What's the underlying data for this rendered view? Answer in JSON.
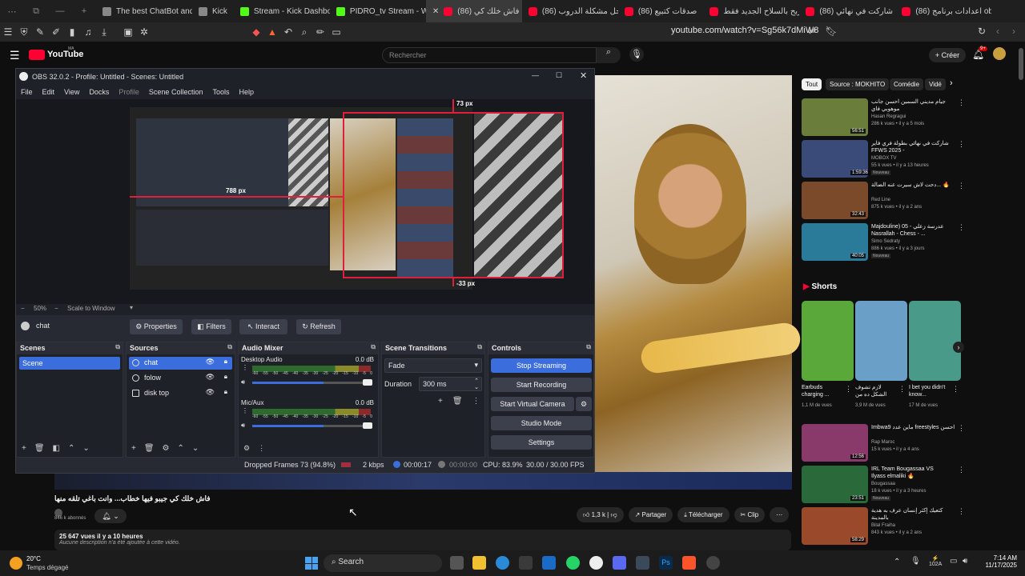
{
  "browser": {
    "tabs": [
      {
        "label": "The best ChatBot and",
        "icon": "gray"
      },
      {
        "label": "Kick",
        "icon": "gray"
      },
      {
        "label": "Stream - Kick Dashbo",
        "icon": "kick"
      },
      {
        "label": "PIDRO_tv Stream - Wa",
        "icon": "kick"
      },
      {
        "label": "(86) فاش خلك كي",
        "icon": "yt",
        "active": true
      },
      {
        "label": "(86) حل مشكلة الدروب",
        "icon": "yt"
      },
      {
        "label": "(86) صدقات كتبيع",
        "icon": "yt"
      },
      {
        "label": "الربح بالسلاح الجديد فقط",
        "icon": "yt"
      },
      {
        "label": "(86) شاركت في نهائي",
        "icon": "yt"
      },
      {
        "label": "(86) اعدادات برنامج obs",
        "icon": "yt"
      }
    ],
    "url": "youtube.com/watch?v=Sg56k7dMiW8"
  },
  "youtube": {
    "logo": "YouTube",
    "logo_region": "MA",
    "search_placeholder": "Rechercher",
    "create_label": "Créer",
    "notif_count": "9+",
    "chips": [
      "Tout",
      "Source : MOKHITO",
      "Comédie",
      "Vidé"
    ],
    "recommendations": [
      {
        "title": "جيام مديني السمين احسن جانب موهوبي فاي",
        "title2": "الاوروبية بسبب ناصبة وعادي ..دير كذا",
        "channel": "Hasan Regragui",
        "views": "286 k vues • il y a 5 mois",
        "duration": "56:51",
        "color": "#6b7d3a"
      },
      {
        "title": "شاركت في نهائي بطولة فري فاير",
        "title2": "FFWS 2025 -",
        "channel": "MOBOX TV",
        "views": "55 k vues • il y a 13 heures",
        "badge": "Nouveau",
        "duration": "1:59:36",
        "color": "#3a4b7a"
      },
      {
        "title": "دحت لاش سيرت عنه الضالة... 🔥",
        "channel": "Red Line",
        "views": "875 k vues • il y a 2 ans",
        "duration": "32:43",
        "color": "#7a4a2a"
      },
      {
        "title": "Majdouline) 05 - عدرسة زعلي",
        "title2": "Nasrallah - Chess - ...",
        "channel": "Simo Sedraty",
        "views": "886 k vues • il y a 3 jours",
        "badge": "Nouveau",
        "duration": "40:05",
        "color": "#2a7a9a"
      }
    ],
    "shorts_title": "Shorts",
    "shorts": [
      {
        "title": "Earbuds charging ...",
        "views": "1,1 M de vues",
        "color": "#5aa83a"
      },
      {
        "title": "لازم تشوف الشكل ده من جهازك ملك!",
        "views": "3,9 M de vues",
        "color": "#6aa0c8"
      },
      {
        "title": "I bet you didn't know...",
        "views": "17 M de vues",
        "color": "#4a9a8a"
      }
    ],
    "recommendations2": [
      {
        "title": "Imbwa9 ماين عدد freestyles احسن",
        "channel": "Rap Maroc",
        "views": "15 k vues • il y a 4 ans",
        "duration": "12:56",
        "color": "#8a3a6a"
      },
      {
        "title": "IRL Team Bougassaa VS",
        "title2": "Ilyass elmaliki 🔥",
        "channel": "Bougassaa",
        "views": "18 k vues • il y a 3 heures",
        "badge": "Nouveau",
        "duration": "23:51",
        "color": "#2a6a3a"
      },
      {
        "title": "كتعيك إكثر إنسان عرف به هدية بالمدينة",
        "title2": "Moroccan Web Legende - ep...",
        "channel": "Bilal Fraiha",
        "views": "843 k vues • il y a 2 ans",
        "duration": "58:29",
        "color": "#9a4a2a"
      }
    ],
    "video_title": "فاش خلك كي جيبو فيها خطاب... وانت باغي تلقه منها",
    "channel_subs": "846 k abonnés",
    "actions": {
      "like": "1,3 k",
      "share": "Partager",
      "download": "Télécharger",
      "clip": "Clip"
    },
    "desc_line1": "25 647 vues il y a 10 heures",
    "desc_line2": "Aucune description n'a été ajoutée à cette vidéo."
  },
  "obs": {
    "title": "OBS 32.0.2 - Profile: Untitled - Scenes: Untitled",
    "menu": [
      "File",
      "Edit",
      "View",
      "Docks",
      "Profile",
      "Scene Collection",
      "Tools",
      "Help"
    ],
    "preview_labels": {
      "top": "73 px",
      "left": "788 px",
      "bottom": "-33 px"
    },
    "zoom": "50%",
    "scale": "Scale to Window",
    "selected_source": "chat",
    "source_buttons": {
      "properties": "Properties",
      "filters": "Filters",
      "interact": "Interact",
      "refresh": "Refresh"
    },
    "docks": {
      "scenes": "Scenes",
      "sources": "Sources",
      "audio": "Audio Mixer",
      "transitions": "Scene Transitions",
      "controls": "Controls"
    },
    "scenes": [
      "Scene"
    ],
    "sources": [
      "chat",
      "folow",
      "disk top"
    ],
    "audio": [
      {
        "name": "Desktop Audio",
        "db": "0.0 dB",
        "level": 0.6
      },
      {
        "name": "Mic/Aux",
        "db": "0.0 dB",
        "level": 0.6
      }
    ],
    "meter_ticks": [
      "-60",
      "-55",
      "-50",
      "-45",
      "-40",
      "-35",
      "-30",
      "-25",
      "-20",
      "-15",
      "-10",
      "-5",
      "0"
    ],
    "transition": "Fade",
    "duration_label": "Duration",
    "duration": "300 ms",
    "controls": [
      "Stop Streaming",
      "Start Recording",
      "Start Virtual Camera",
      "Studio Mode",
      "Settings"
    ],
    "status": {
      "dropped": "Dropped Frames 73 (94.8%)",
      "kbps": "2 kbps",
      "stream_time": "00:00:17",
      "rec_time": "00:00:00",
      "cpu": "CPU: 83.9%",
      "fps": "30.00 / 30.00 FPS"
    }
  },
  "taskbar": {
    "weather_temp": "20°C",
    "weather_desc": "Temps dégagé",
    "search": "Search",
    "time": "7:14 AM",
    "date": "11/17/2025",
    "battery": "102A"
  }
}
